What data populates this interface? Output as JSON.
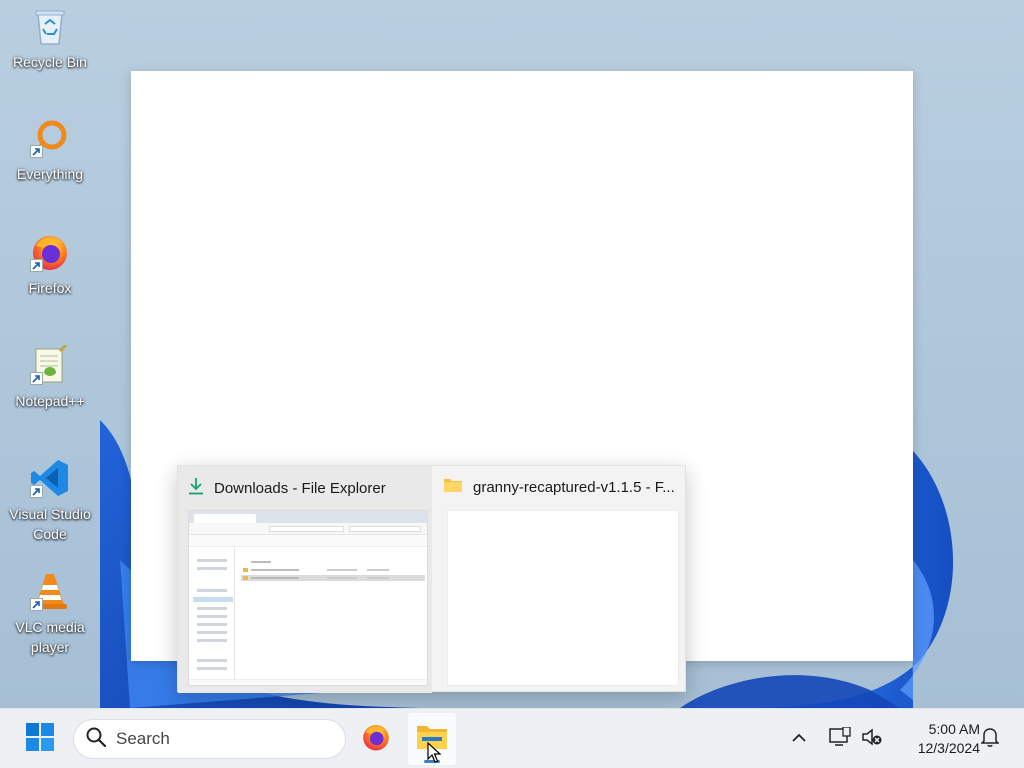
{
  "desktop": {
    "icons": [
      {
        "label": "Recycle Bin",
        "icon": "recycle-bin-icon"
      },
      {
        "label": "Everything",
        "icon": "everything-search-icon"
      },
      {
        "label": "Firefox",
        "icon": "firefox-icon"
      },
      {
        "label": "Notepad++",
        "icon": "notepad-plus-plus-icon"
      },
      {
        "label": "Visual Studio Code",
        "icon": "vscode-icon"
      },
      {
        "label": "VLC media player",
        "icon": "vlc-icon"
      }
    ]
  },
  "thumbnail_popup": {
    "items": [
      {
        "title": "Downloads - File Explorer",
        "icon": "download-arrow-icon"
      },
      {
        "title": "granny-recaptured-v1.1.5 - F...",
        "icon": "folder-icon"
      }
    ]
  },
  "taskbar": {
    "search_placeholder": "Search",
    "pinned": [
      "start-icon",
      "firefox-icon",
      "file-explorer-icon"
    ],
    "clock": {
      "time": "5:00 AM",
      "date": "12/3/2024"
    }
  },
  "colors": {
    "accent": "#0067c0",
    "taskbar_bg": "#eef0f3",
    "folder_yellow": "#f5c242"
  }
}
